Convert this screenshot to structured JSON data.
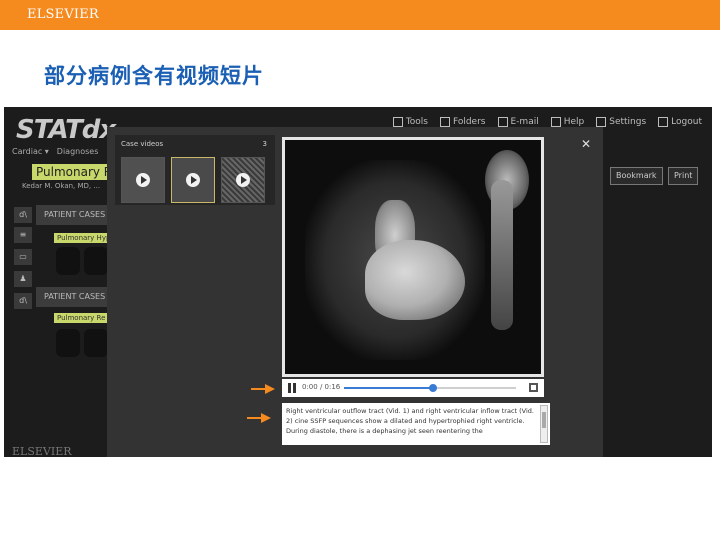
{
  "slide": {
    "publisher_logo": "ELSEVIER",
    "title": "部分病例含有视频短片",
    "accent_color": "#f58a1f",
    "title_color": "#1a5fb4"
  },
  "app": {
    "logo": "STATdx",
    "top_icons": [
      {
        "name": "tools-icon",
        "label": "Tools"
      },
      {
        "name": "folders-icon",
        "label": "Folders"
      },
      {
        "name": "email-icon",
        "label": "E-mail"
      },
      {
        "name": "help-icon",
        "label": "Help"
      },
      {
        "name": "settings-icon",
        "label": "Settings"
      },
      {
        "name": "logout-icon",
        "label": "Logout"
      }
    ],
    "nav": [
      "Cardiac ▾",
      "Diagnoses"
    ],
    "topic": "Pulmonary Re",
    "author": "Kedar M. Okan, MD, ...",
    "bookmark_label": "Bookmark",
    "print_label": "Print",
    "patient_cases_label": "PATIENT CASES",
    "sub_labels": [
      "Pulmonary Hyp",
      "Pulmonary Re"
    ],
    "footer_logo": "ELSEVIER"
  },
  "modal": {
    "panel_title": "Case videos",
    "panel_count": "3",
    "close_label": "✕",
    "time": "0:00 / 0:16",
    "progress": 0.52,
    "caption": "Right ventricular outflow tract (Vid. 1) and right ventricular inflow tract (Vid. 2) cine SSFP sequences show a dilated and hypertrophied right ventricle. During diastole, there is a dephasing jet seen reentering the"
  }
}
